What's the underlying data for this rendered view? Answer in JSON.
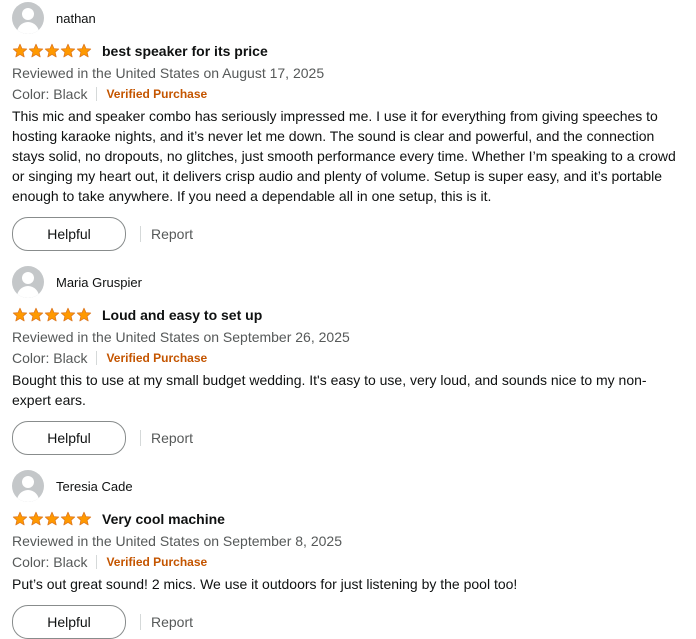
{
  "colors": {
    "star": "#ff9900",
    "verified": "#c45500",
    "secondary_text": "#565959",
    "primary_text": "#0f1111"
  },
  "icons": {
    "avatar": "user-avatar-icon",
    "star": "star-icon"
  },
  "reviews": [
    {
      "profile_name": "nathan",
      "rating": 5,
      "title": "best speaker for its price",
      "date": "Reviewed in the United States on August 17, 2025",
      "color": "Color: Black",
      "verified": "Verified Purchase",
      "body": "This mic and speaker combo has seriously impressed me. I use it for everything from giving speeches to hosting karaoke nights, and it’s never let me down. The sound is clear and powerful, and the connection stays solid, no dropouts, no glitches, just smooth performance every time. Whether I’m speaking to a crowd or singing my heart out, it delivers crisp audio and plenty of volume. Setup is super easy, and it’s portable enough to take anywhere. If you need a dependable all in one setup, this is it.",
      "helpful_label": "Helpful",
      "report_label": "Report"
    },
    {
      "profile_name": "Maria Gruspier",
      "rating": 5,
      "title": "Loud and easy to set up",
      "date": "Reviewed in the United States on September 26, 2025",
      "color": "Color: Black",
      "verified": "Verified Purchase",
      "body": "Bought this to use at my small budget wedding. It's easy to use, very loud, and sounds nice to my non-expert ears.",
      "helpful_label": "Helpful",
      "report_label": "Report"
    },
    {
      "profile_name": "Teresia Cade",
      "rating": 5,
      "title": "Very cool machine",
      "date": "Reviewed in the United States on September 8, 2025",
      "color": "Color: Black",
      "verified": "Verified Purchase",
      "body": "Put’s out great sound! 2 mics. We use it outdoors for just listening by the pool too!",
      "helpful_label": "Helpful",
      "report_label": "Report"
    }
  ]
}
